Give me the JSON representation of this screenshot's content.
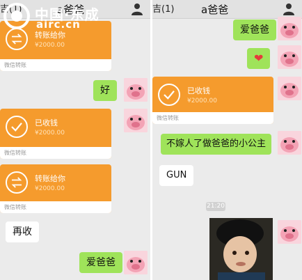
{
  "watermark": {
    "text_cn": "中国·东成",
    "text_en": "airc.cn"
  },
  "left_pane": {
    "back_label": "吉(1)",
    "title": "a爸爸",
    "messages": [
      {
        "type": "transfer",
        "title": "转账给你",
        "amount": "¥2000.00",
        "footer": "微信转账"
      },
      {
        "type": "text",
        "text": "好"
      },
      {
        "type": "transfer",
        "title": "已收钱",
        "amount": "¥2000.00",
        "footer": "微信转账"
      },
      {
        "type": "transfer",
        "title": "转账给你",
        "amount": "¥2000.00",
        "footer": "微信转账"
      },
      {
        "type": "text",
        "text": "再收"
      },
      {
        "type": "text",
        "text": "爱爸爸"
      }
    ]
  },
  "right_pane": {
    "back_label": "吉(1)",
    "title": "a爸爸",
    "time_label": "21:20",
    "messages": [
      {
        "type": "text",
        "text": "爱爸爸"
      },
      {
        "type": "text",
        "text": "❤"
      },
      {
        "type": "transfer",
        "title": "已收钱",
        "amount": "¥2000.00",
        "footer": "微信转账"
      },
      {
        "type": "text",
        "text": "不嫁人了做爸爸的小公主"
      },
      {
        "type": "text",
        "text": "GUN"
      }
    ]
  },
  "colors": {
    "transfer_orange": "#f59b2d",
    "bubble_green": "#9fe35a",
    "background": "#ebebeb"
  }
}
